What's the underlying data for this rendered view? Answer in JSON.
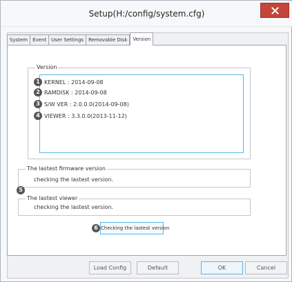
{
  "window": {
    "title": "Setup(H:/config/system.cfg)",
    "close_icon": "close-x-icon",
    "close_color": "#c4453a"
  },
  "tabs": [
    {
      "label": "System",
      "active": false
    },
    {
      "label": "Event",
      "active": false
    },
    {
      "label": "User Settings",
      "active": false
    },
    {
      "label": "Removable Disk",
      "active": false
    },
    {
      "label": "Version",
      "active": true
    }
  ],
  "version_group": {
    "legend": "Version",
    "lines": [
      {
        "badge": "1",
        "text": "KERNEL : 2014-09-08"
      },
      {
        "badge": "2",
        "text": "RAMDISK : 2014-09-08"
      },
      {
        "badge": "3",
        "text": "S/W VER : 2.0.0.0(2014-09-08)"
      },
      {
        "badge": "4",
        "text": "VIEWER : 3.3.0.0(2013-11-12)"
      }
    ]
  },
  "firmware_group": {
    "legend": "The lastest firmware version",
    "status": "checking the lastest version."
  },
  "viewer_group": {
    "legend": "The lastest viewer",
    "status": "checking the lastest version."
  },
  "markers": {
    "five": "5",
    "six": "6"
  },
  "check_button": {
    "label": "Checking the lastest version"
  },
  "footer": {
    "load_config": "Load Config",
    "default": "Default",
    "ok": "OK",
    "cancel": "Cancel"
  },
  "colors": {
    "accent": "#59b6e8",
    "badge": "#555555"
  }
}
